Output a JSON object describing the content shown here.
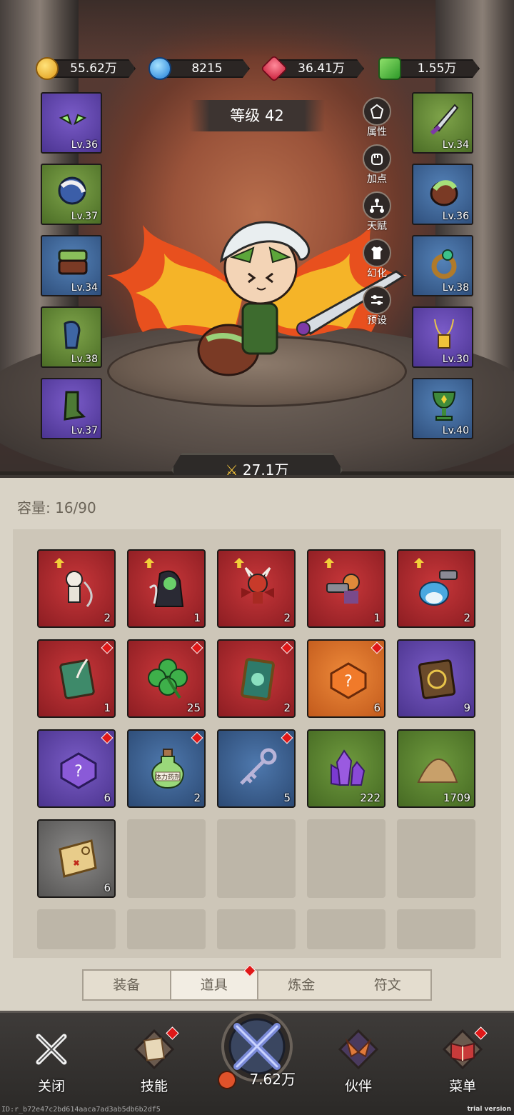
{
  "currencies": [
    {
      "name": "gold",
      "value": "55.62万",
      "color": "#f2b52a"
    },
    {
      "name": "diamond",
      "value": "8215",
      "color": "#2a9df2"
    },
    {
      "name": "ruby",
      "value": "36.41万",
      "color": "#e0304a"
    },
    {
      "name": "cash",
      "value": "1.55万",
      "color": "#4cc24a"
    }
  ],
  "hero": {
    "level_label": "等级 42",
    "power": "27.1万"
  },
  "side_buttons": [
    "属性",
    "加点",
    "天赋",
    "幻化",
    "预设"
  ],
  "equipment": {
    "left": [
      {
        "lv": "Lv.36",
        "rarity": "purple",
        "icon": "mask-icon"
      },
      {
        "lv": "Lv.37",
        "rarity": "green",
        "icon": "pauldron-icon"
      },
      {
        "lv": "Lv.34",
        "rarity": "blue",
        "icon": "belt-icon"
      },
      {
        "lv": "Lv.38",
        "rarity": "green",
        "icon": "bracer-icon"
      },
      {
        "lv": "Lv.37",
        "rarity": "purple",
        "icon": "boots-icon"
      }
    ],
    "right": [
      {
        "lv": "Lv.34",
        "rarity": "green",
        "icon": "sword-icon"
      },
      {
        "lv": "Lv.36",
        "rarity": "blue",
        "icon": "shield-icon"
      },
      {
        "lv": "Lv.38",
        "rarity": "blue",
        "icon": "ring-icon"
      },
      {
        "lv": "Lv.30",
        "rarity": "purple",
        "icon": "necklace-icon"
      },
      {
        "lv": "Lv.40",
        "rarity": "blue",
        "icon": "goblet-icon"
      }
    ]
  },
  "inventory": {
    "capacity": "容量: 16/90",
    "items": [
      {
        "count": "2",
        "rarity": "red",
        "icon": "skeleton-pet-icon",
        "upgrade": true,
        "badge": false
      },
      {
        "count": "1",
        "rarity": "red",
        "icon": "reaper-pet-icon",
        "upgrade": true,
        "badge": false
      },
      {
        "count": "2",
        "rarity": "red",
        "icon": "demon-pet-icon",
        "upgrade": true,
        "badge": false
      },
      {
        "count": "1",
        "rarity": "red",
        "icon": "gunner-pet-icon",
        "upgrade": true,
        "badge": false
      },
      {
        "count": "2",
        "rarity": "red",
        "icon": "shark-pet-icon",
        "upgrade": true,
        "badge": false
      },
      {
        "count": "1",
        "rarity": "red",
        "icon": "green-book-icon",
        "upgrade": false,
        "badge": true
      },
      {
        "count": "25",
        "rarity": "red",
        "icon": "clover-icon",
        "upgrade": false,
        "badge": true
      },
      {
        "count": "2",
        "rarity": "red",
        "icon": "card-icon",
        "upgrade": false,
        "badge": true
      },
      {
        "count": "6",
        "rarity": "orange",
        "icon": "orange-puzzle-icon",
        "upgrade": false,
        "badge": true
      },
      {
        "count": "9",
        "rarity": "purple",
        "icon": "tome-icon",
        "upgrade": false,
        "badge": false
      },
      {
        "count": "6",
        "rarity": "purple",
        "icon": "purple-puzzle-icon",
        "upgrade": false,
        "badge": true
      },
      {
        "count": "2",
        "rarity": "blue",
        "icon": "potion-icon",
        "upgrade": false,
        "badge": true,
        "label": "体力药剂"
      },
      {
        "count": "5",
        "rarity": "blue",
        "icon": "key-icon",
        "upgrade": false,
        "badge": true
      },
      {
        "count": "222",
        "rarity": "green",
        "icon": "crystal-icon",
        "upgrade": false,
        "badge": false
      },
      {
        "count": "1709",
        "rarity": "green",
        "icon": "sand-icon",
        "upgrade": false,
        "badge": false
      },
      {
        "count": "6",
        "rarity": "gray",
        "icon": "map-icon",
        "upgrade": false,
        "badge": false
      }
    ]
  },
  "tabs": [
    {
      "label": "装备",
      "active": false,
      "badge": false
    },
    {
      "label": "道具",
      "active": true,
      "badge": true
    },
    {
      "label": "炼金",
      "active": false,
      "badge": false
    },
    {
      "label": "符文",
      "active": false,
      "badge": false
    }
  ],
  "nav": {
    "close": "关闭",
    "skills": "技能",
    "center_value": "7.62万",
    "partner": "伙伴",
    "menu": "菜单"
  },
  "footer": {
    "id": "ID:r_b72e47c2bd614aaca7ad3ab5db6b2df5",
    "trial": "trial version"
  }
}
